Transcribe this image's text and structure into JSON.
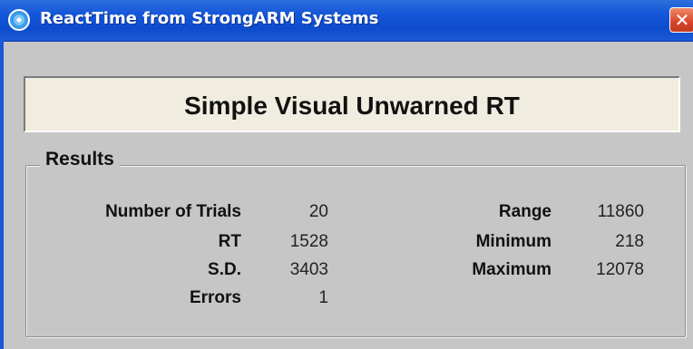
{
  "window": {
    "title": "ReactTime from StrongARM Systems",
    "close_glyph": "✕",
    "icon": "globe-icon"
  },
  "test_name": "Simple Visual Unwarned RT",
  "results": {
    "legend": "Results",
    "left": [
      {
        "label": "Number of Trials",
        "value": "20"
      },
      {
        "label": "RT",
        "value": "1528"
      },
      {
        "label": "S.D.",
        "value": "3403"
      },
      {
        "label": "Errors",
        "value": "1"
      }
    ],
    "right": [
      {
        "label": "Range",
        "value": "11860"
      },
      {
        "label": "Minimum",
        "value": "218"
      },
      {
        "label": "Maximum",
        "value": "12078"
      }
    ]
  },
  "colors": {
    "titlebar": "#1456d8",
    "window_bg": "#c6c6c6",
    "heading_bg": "#f0ede0",
    "close_button": "#d9442a"
  }
}
